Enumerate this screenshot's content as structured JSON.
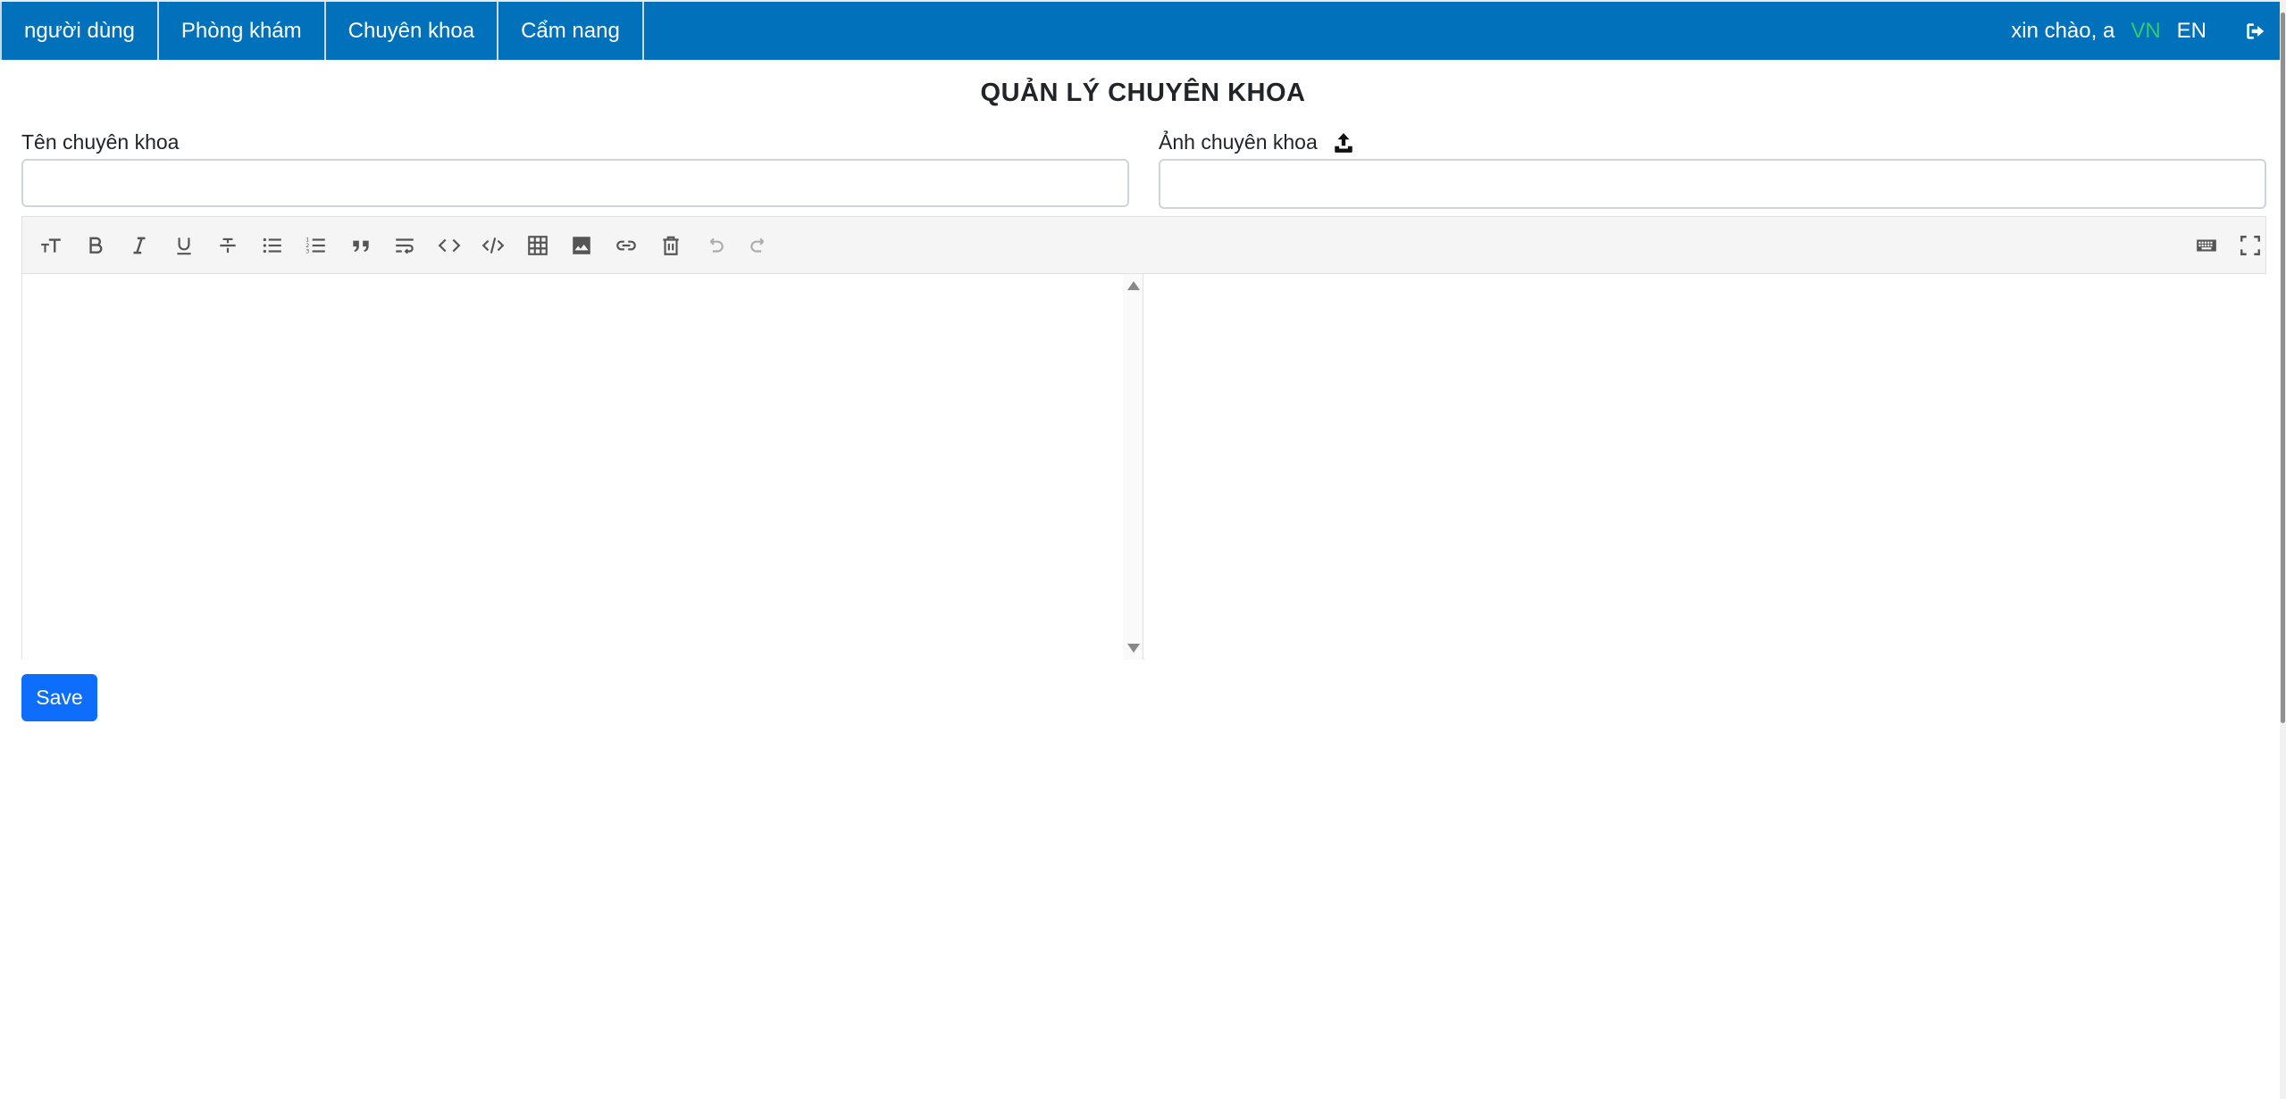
{
  "nav": {
    "items": [
      {
        "label": "người dùng"
      },
      {
        "label": "Phòng khám"
      },
      {
        "label": "Chuyên khoa"
      },
      {
        "label": "Cẩm nang"
      }
    ],
    "greeting": "xin chào, a",
    "languages": [
      {
        "label": "VN",
        "active": true
      },
      {
        "label": "EN",
        "active": false
      }
    ],
    "logout_icon": "sign-out-icon",
    "colors": {
      "bar": "#0071ba",
      "active_lang": "#2ecc71"
    }
  },
  "page": {
    "title": "QUẢN LÝ CHUYÊN KHOA"
  },
  "form": {
    "name_label": "Tên chuyên khoa",
    "name_value": "",
    "image_label": "Ảnh chuyên khoa",
    "image_value": "",
    "upload_icon": "upload-icon"
  },
  "editor": {
    "toolbar": [
      {
        "icon": "font-size-icon"
      },
      {
        "icon": "bold-icon"
      },
      {
        "icon": "italic-icon"
      },
      {
        "icon": "underline-icon"
      },
      {
        "icon": "strikethrough-icon"
      },
      {
        "icon": "unordered-list-icon"
      },
      {
        "icon": "ordered-list-icon"
      },
      {
        "icon": "quote-icon"
      },
      {
        "icon": "wrap-icon"
      },
      {
        "icon": "inline-code-icon"
      },
      {
        "icon": "code-block-icon"
      },
      {
        "icon": "table-icon"
      },
      {
        "icon": "image-icon"
      },
      {
        "icon": "link-icon"
      },
      {
        "icon": "clear-icon"
      },
      {
        "icon": "undo-icon",
        "disabled": true
      },
      {
        "icon": "redo-icon",
        "disabled": true
      }
    ],
    "toolbar_right": [
      {
        "icon": "keyboard-icon"
      },
      {
        "icon": "fullscreen-icon"
      }
    ],
    "markdown_value": ""
  },
  "actions": {
    "save_label": "Save",
    "save_color": "#0d6efd"
  }
}
